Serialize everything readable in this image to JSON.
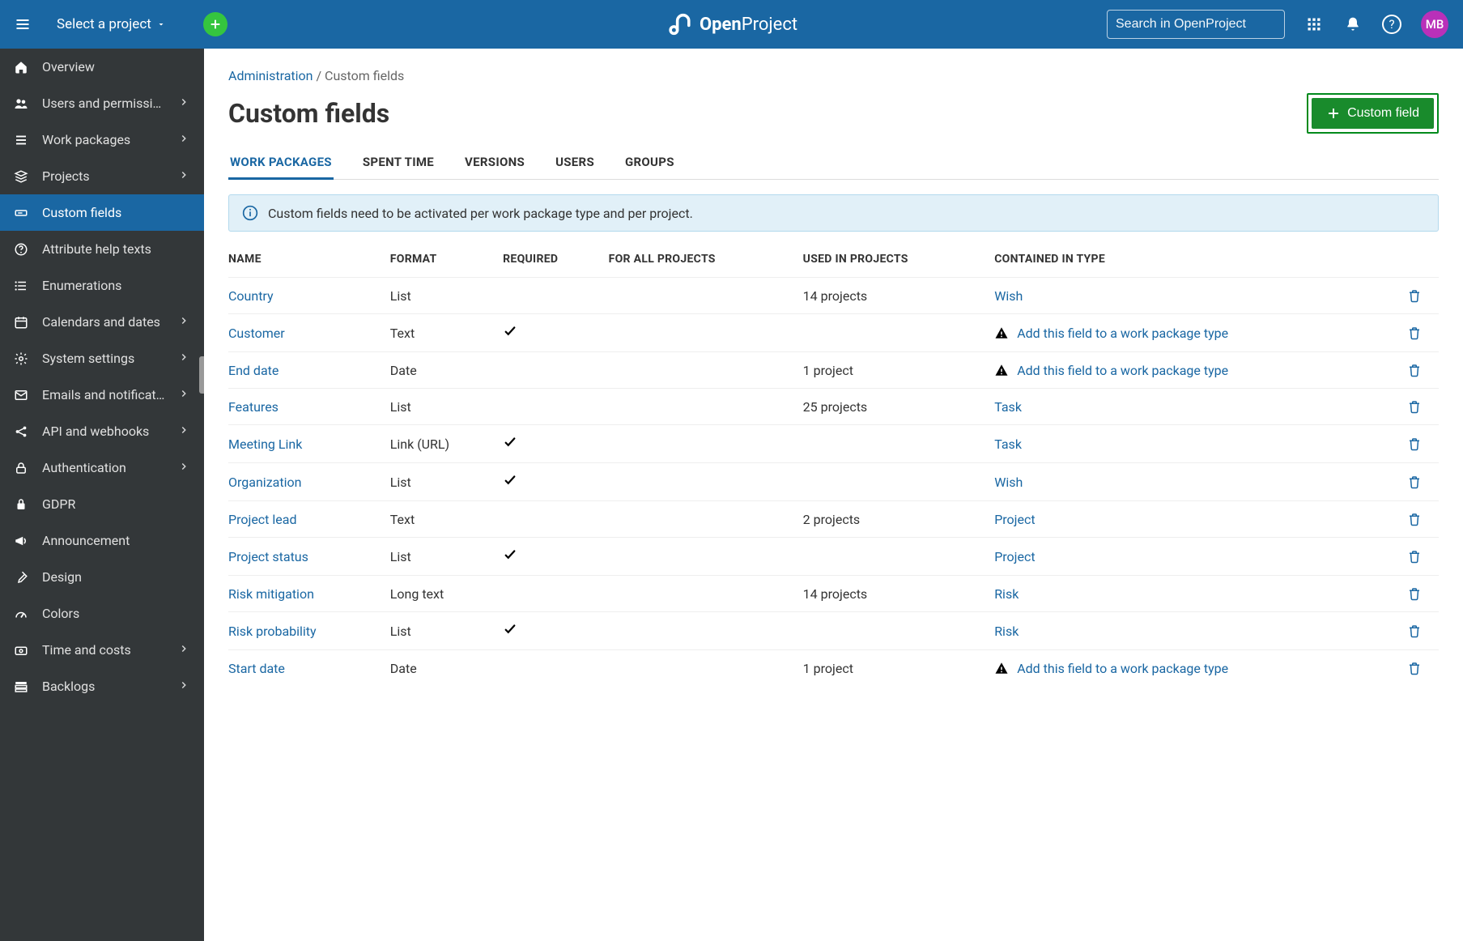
{
  "header": {
    "project_selector": "Select a project",
    "brand_bold": "Open",
    "brand_light": "Project",
    "search_placeholder": "Search in OpenProject",
    "avatar_initials": "MB"
  },
  "sidebar": {
    "items": [
      {
        "label": "Overview",
        "icon": "home",
        "arrow": false
      },
      {
        "label": "Users and permissi…",
        "icon": "users",
        "arrow": true
      },
      {
        "label": "Work packages",
        "icon": "lines",
        "arrow": true
      },
      {
        "label": "Projects",
        "icon": "stack",
        "arrow": true
      },
      {
        "label": "Custom fields",
        "icon": "field",
        "arrow": false,
        "active": true
      },
      {
        "label": "Attribute help texts",
        "icon": "help",
        "arrow": false
      },
      {
        "label": "Enumerations",
        "icon": "enum",
        "arrow": false
      },
      {
        "label": "Calendars and dates",
        "icon": "calendar",
        "arrow": true
      },
      {
        "label": "System settings",
        "icon": "gear",
        "arrow": true
      },
      {
        "label": "Emails and notificat…",
        "icon": "mail",
        "arrow": true
      },
      {
        "label": "API and webhooks",
        "icon": "api",
        "arrow": true
      },
      {
        "label": "Authentication",
        "icon": "lock",
        "arrow": true
      },
      {
        "label": "GDPR",
        "icon": "padlock",
        "arrow": false
      },
      {
        "label": "Announcement",
        "icon": "megaphone",
        "arrow": false
      },
      {
        "label": "Design",
        "icon": "brush",
        "arrow": false
      },
      {
        "label": "Colors",
        "icon": "gauge",
        "arrow": false
      },
      {
        "label": "Time and costs",
        "icon": "money",
        "arrow": true
      },
      {
        "label": "Backlogs",
        "icon": "backlog",
        "arrow": true
      }
    ]
  },
  "breadcrumb": {
    "parent": "Administration",
    "current": "Custom fields"
  },
  "page": {
    "title": "Custom fields",
    "new_button": "Custom field",
    "info": "Custom fields need to be activated per work package type and per project."
  },
  "tabs": [
    {
      "label": "Work packages",
      "active": true
    },
    {
      "label": "Spent time"
    },
    {
      "label": "Versions"
    },
    {
      "label": "Users"
    },
    {
      "label": "Groups"
    }
  ],
  "table": {
    "headers": {
      "name": "Name",
      "format": "Format",
      "required": "Required",
      "for_all": "For all projects",
      "used_in": "Used in projects",
      "contained": "Contained in type"
    },
    "add_type_text": "Add this field to a work package type",
    "rows": [
      {
        "name": "Country",
        "format": "List",
        "required": false,
        "for_all": false,
        "used_in": "14 projects",
        "type": "Wish"
      },
      {
        "name": "Customer",
        "format": "Text",
        "required": true,
        "for_all": false,
        "used_in": "",
        "type_warn": true
      },
      {
        "name": "End date",
        "format": "Date",
        "required": false,
        "for_all": false,
        "used_in": "1 project",
        "type_warn": true
      },
      {
        "name": "Features",
        "format": "List",
        "required": false,
        "for_all": false,
        "used_in": "25 projects",
        "type": "Task"
      },
      {
        "name": "Meeting Link",
        "format": "Link (URL)",
        "required": true,
        "for_all": false,
        "used_in": "",
        "type": "Task"
      },
      {
        "name": "Organization",
        "format": "List",
        "required": true,
        "for_all": false,
        "used_in": "",
        "type": "Wish"
      },
      {
        "name": "Project lead",
        "format": "Text",
        "required": false,
        "for_all": false,
        "used_in": "2 projects",
        "type": "Project"
      },
      {
        "name": "Project status",
        "format": "List",
        "required": true,
        "for_all": false,
        "used_in": "",
        "type": "Project"
      },
      {
        "name": "Risk mitigation",
        "format": "Long text",
        "required": false,
        "for_all": false,
        "used_in": "14 projects",
        "type": "Risk"
      },
      {
        "name": "Risk probability",
        "format": "List",
        "required": true,
        "for_all": false,
        "used_in": "",
        "type": "Risk"
      },
      {
        "name": "Start date",
        "format": "Date",
        "required": false,
        "for_all": false,
        "used_in": "1 project",
        "type_warn": true
      }
    ]
  }
}
